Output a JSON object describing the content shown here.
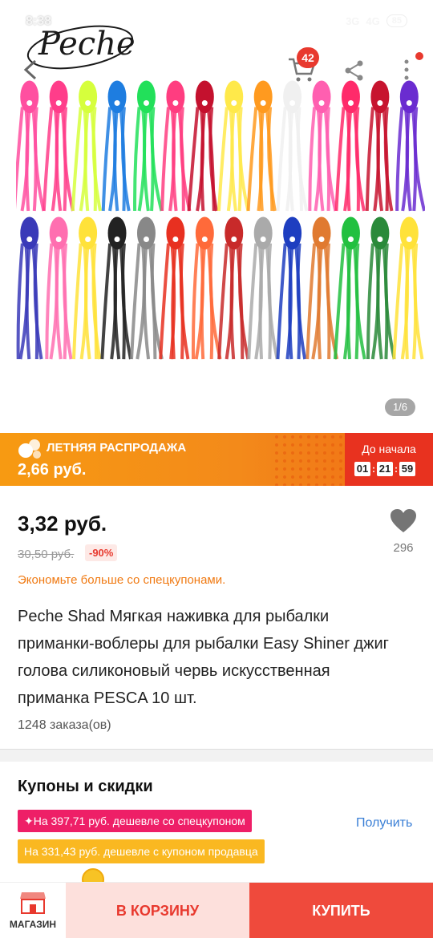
{
  "status_bar": {
    "time": "8:38",
    "network1": "3G",
    "network2": "4G",
    "battery": "85"
  },
  "header": {
    "logo_text": "Peche",
    "cart_count": "42",
    "image_counter": "1/6"
  },
  "sale_banner": {
    "title": "ЛЕТНЯЯ РАСПРОДАЖА",
    "price": "2,66 руб.",
    "countdown_label": "До начала",
    "hours": "01",
    "minutes": "21",
    "seconds": "59"
  },
  "product": {
    "price": "3,32 руб.",
    "old_price": "30,50 руб.",
    "discount": "-90%",
    "likes": "296",
    "coupon_hint": "Экономьте больше со спецкупонами.",
    "title": "Peche Shad Мягкая наживка для рыбалки приманки-воблеры для рыбалки Easy Shiner джиг голова силиконовый червь искусственная приманка PESCA 10 шт.",
    "orders": "1248 заказа(ов)"
  },
  "coupons": {
    "title": "Купоны и скидки",
    "coupon1": "✦На 397,71 руб. дешевле со спецкупоном",
    "coupon2": "На 331,43 руб. дешевле с купоном продавца",
    "get_label": "Получить"
  },
  "bottom_bar": {
    "store_label": "МАГАЗИН",
    "add_to_cart": "В КОРЗИНУ",
    "buy": "КУПИТЬ"
  },
  "colors": {
    "accent_red": "#e8392e",
    "sale_orange": "#f38a1a",
    "coupon_pink": "#ee1f67",
    "coupon_yellow": "#fab821",
    "link_blue": "#3a7fd6"
  }
}
